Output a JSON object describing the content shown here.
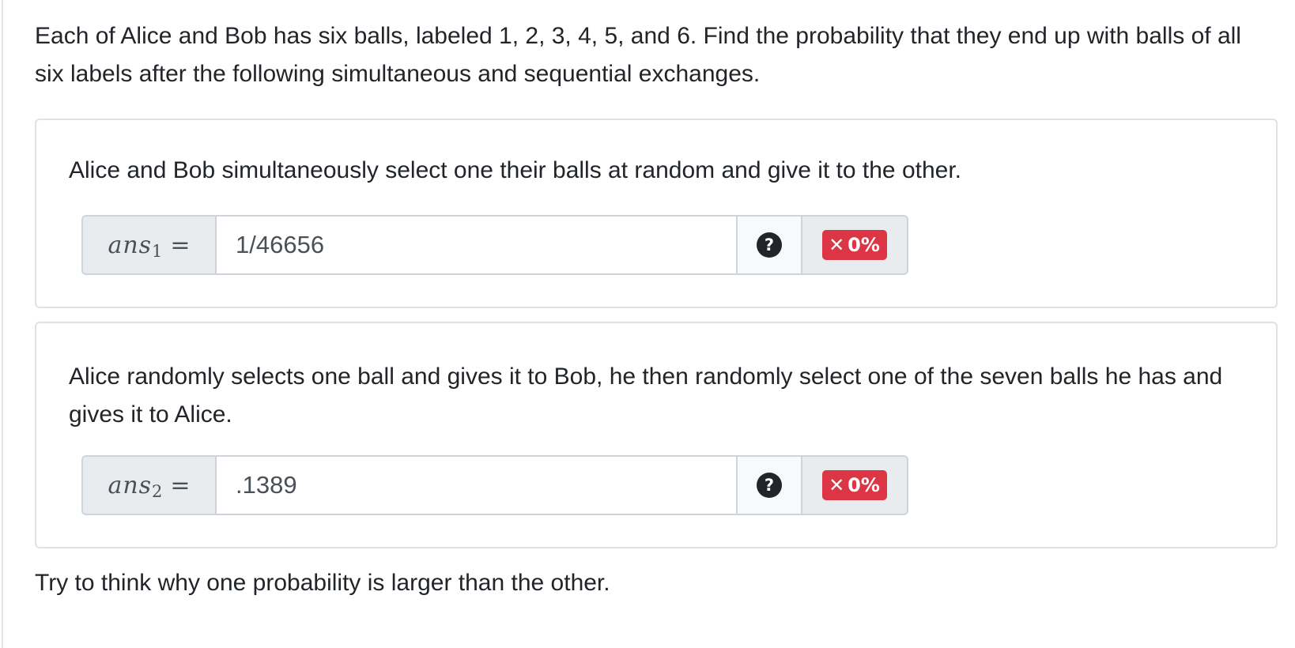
{
  "intro": "Each of Alice and Bob has six balls, labeled 1, 2, 3, 4, 5, and 6. Find the probability that they end up with balls of all six labels after the following simultaneous and sequential exchanges.",
  "parts": [
    {
      "prompt": "Alice and Bob simultaneously select one their balls at random and give it to the other.",
      "var": "ans",
      "sub": "1",
      "eq": "=",
      "value": "1/46656",
      "help": "?",
      "score_icon": "✕",
      "score": "0%"
    },
    {
      "prompt": "Alice randomly selects one ball and gives it to Bob, he then randomly select one of the seven balls he has and gives it to Alice.",
      "var": "ans",
      "sub": "2",
      "eq": "=",
      "value": ".1389",
      "help": "?",
      "score_icon": "✕",
      "score": "0%"
    }
  ],
  "footer": "Try to think why one probability is larger than the other.",
  "colors": {
    "badge_incorrect": "#dc3545",
    "help_icon": "#212529",
    "addon_bg": "#e9ecef",
    "border": "#ced4da"
  }
}
